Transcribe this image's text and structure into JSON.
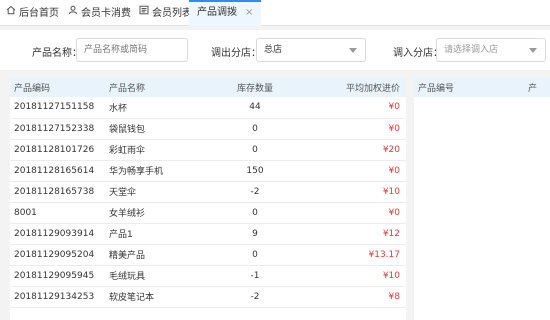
{
  "tabs": [
    {
      "label": "后台首页",
      "icon": "home-icon"
    },
    {
      "label": "会员卡消费",
      "icon": "user-icon"
    },
    {
      "label": "会员列表",
      "icon": "list-icon"
    },
    {
      "label": "产品调拨",
      "icon": "",
      "close": "×"
    }
  ],
  "filters": {
    "name_label": "产品名称：",
    "name_placeholder": "产品名称或简码",
    "out_label": "调出分店：",
    "out_value": "总店",
    "in_label": "调入分店：",
    "in_placeholder": "请选择调入店"
  },
  "table": {
    "headers": {
      "code": "产品编码",
      "name": "产品名称",
      "stock": "库存数量",
      "price": "平均加权进价"
    },
    "rows": [
      {
        "code": "20181127151158",
        "name": "水杯",
        "stock": "44",
        "price": "¥0"
      },
      {
        "code": "20181127152338",
        "name": "袋鼠钱包",
        "stock": "0",
        "price": "¥0"
      },
      {
        "code": "20181128101726",
        "name": "彩虹雨伞",
        "stock": "0",
        "price": "¥20"
      },
      {
        "code": "20181128165614",
        "name": "华为畅享手机",
        "stock": "150",
        "price": "¥0"
      },
      {
        "code": "20181128165738",
        "name": "天堂伞",
        "stock": "-2",
        "price": "¥10"
      },
      {
        "code": "8001",
        "name": "女羊绒衫",
        "stock": "0",
        "price": "¥0"
      },
      {
        "code": "20181129093914",
        "name": "产品1",
        "stock": "9",
        "price": "¥12"
      },
      {
        "code": "20181129095204",
        "name": "精美产品",
        "stock": "0",
        "price": "¥13.17"
      },
      {
        "code": "20181129095945",
        "name": "毛绒玩具",
        "stock": "-1",
        "price": "¥10"
      },
      {
        "code": "20181129134253",
        "name": "软皮笔记本",
        "stock": "-2",
        "price": "¥8"
      }
    ]
  },
  "right_table": {
    "headers": {
      "code": "产品编号",
      "name": "产"
    }
  },
  "colors": {
    "accent": "#2d8cf0",
    "price": "#e4393c",
    "header_bg": "#e9f3fb"
  }
}
